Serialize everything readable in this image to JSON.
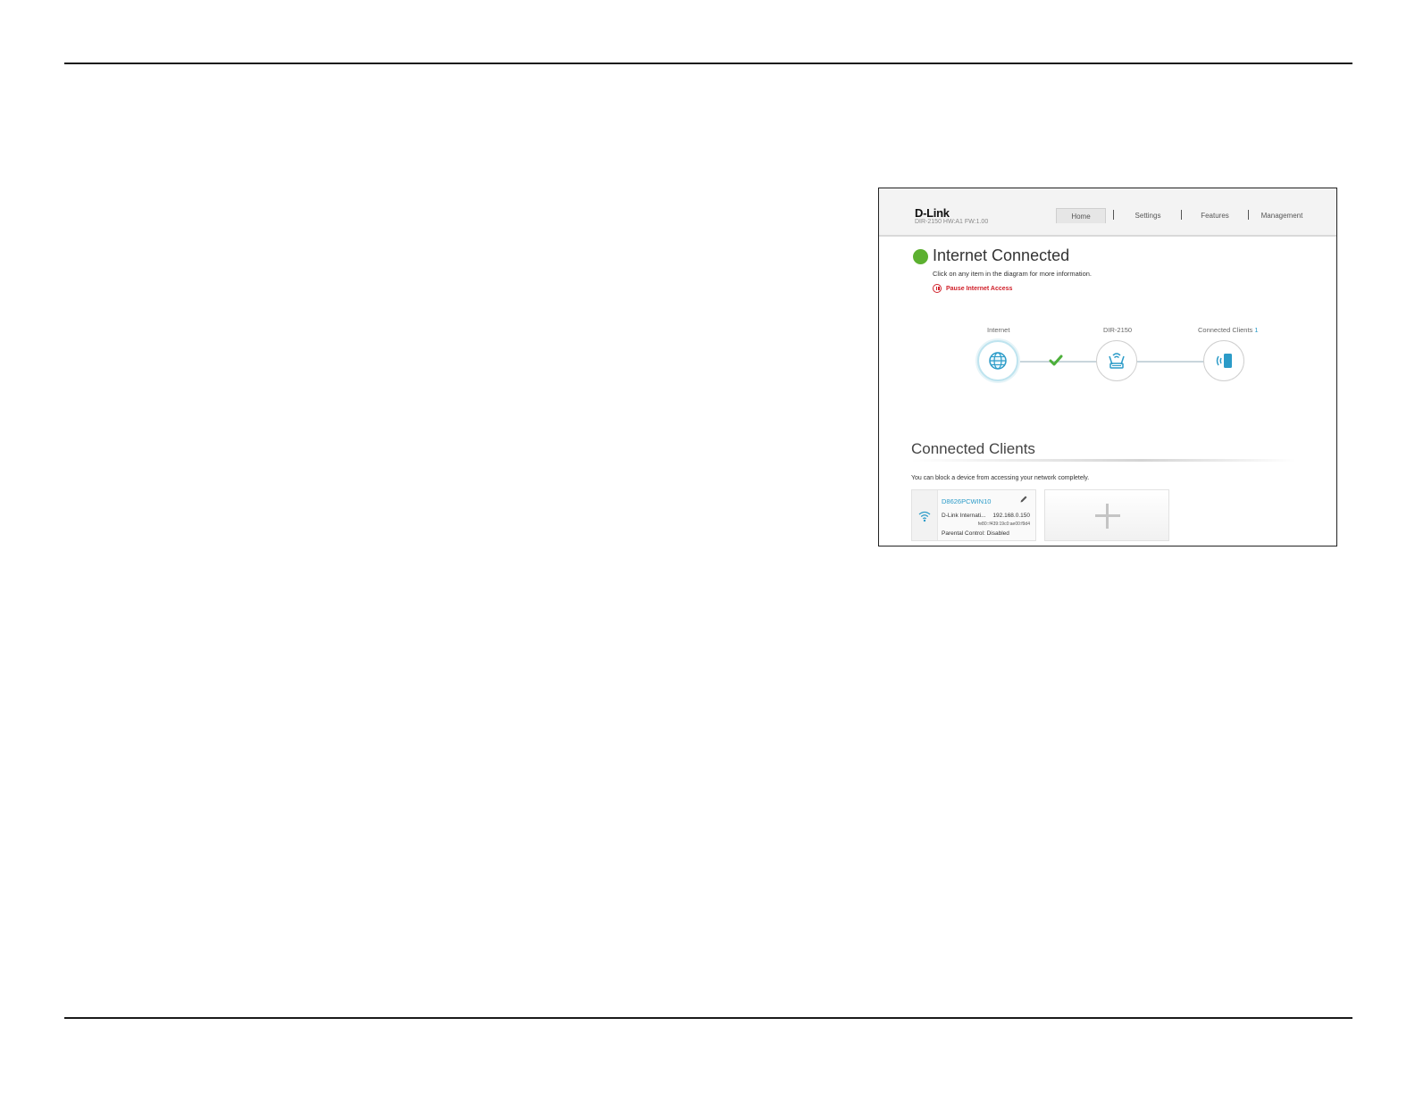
{
  "header": {
    "logo": "D-Link",
    "model": "DIR-2150 HW:A1 FW:1.00",
    "nav": [
      "Home",
      "Settings",
      "Features",
      "Management"
    ]
  },
  "status": {
    "title": "Internet Connected",
    "subtitle": "Click on any item in the diagram for more information.",
    "pause_label": "Pause Internet Access",
    "color": "#5cb030"
  },
  "diagram": {
    "internet_label": "Internet",
    "router_label": "DIR-2150",
    "clients_label": "Connected Clients",
    "clients_count": "1"
  },
  "clients_section": {
    "title": "Connected Clients",
    "description": "You can block a device from accessing your network completely.",
    "client": {
      "name": "D8626PCWIN10",
      "vendor": "D-Link Internati...",
      "ip": "192.168.0.150",
      "ipv6": "fe80::f439:19c0:ae00:f9d4",
      "parental_control": "Parental Control: Disabled"
    }
  },
  "colors": {
    "accent": "#2b9bc8",
    "alert": "#d0202a"
  }
}
